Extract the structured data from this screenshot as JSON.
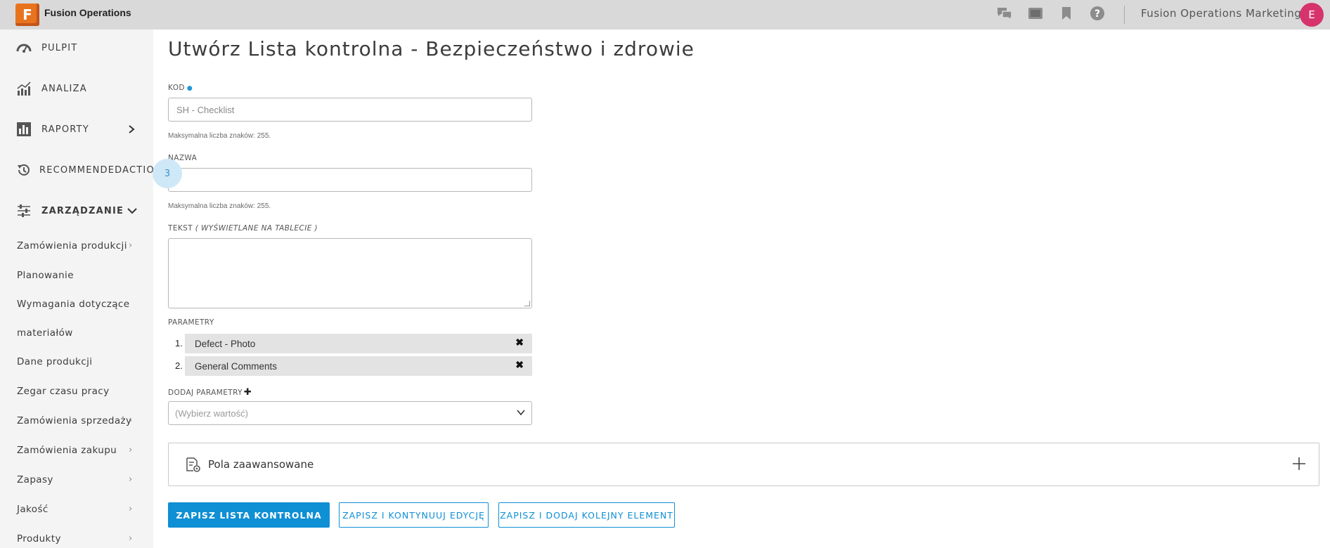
{
  "app": {
    "logo_letter": "F",
    "name": "Fusion Operations"
  },
  "topbar": {
    "icons": [
      "chat-icon",
      "tablet-icon",
      "bookmark-icon",
      "help-icon"
    ],
    "user_name": "Fusion Operations Marketing",
    "avatar_initial": "E"
  },
  "sidebar": {
    "main": [
      {
        "label": "PULPIT",
        "icon": "dashboard-icon"
      },
      {
        "label": "ANALIZA",
        "icon": "analytics-icon"
      },
      {
        "label": "RAPORTY",
        "icon": "reports-icon"
      },
      {
        "label": "RECOMMENDEDACTIONS",
        "icon": "history-icon"
      },
      {
        "label": "ZARZĄDZANIE",
        "icon": "sliders-icon"
      }
    ],
    "recommended_badge": "3",
    "sub": [
      {
        "label": "Zamówienia produkcji"
      },
      {
        "label": "Planowanie"
      },
      {
        "label": "Wymagania dotyczące"
      },
      {
        "label": "materiałów"
      },
      {
        "label": "Dane produkcji"
      },
      {
        "label": "Zegar czasu pracy"
      },
      {
        "label": "Zamówienia sprzedaży"
      },
      {
        "label": "Zamówienia zakupu"
      },
      {
        "label": "Zapasy"
      },
      {
        "label": "Jakość"
      },
      {
        "label": "Produkty"
      }
    ]
  },
  "form": {
    "title": "Utwórz Lista kontrolna - Bezpieczeństwo i zdrowie",
    "kod": {
      "label": "KOD",
      "placeholder": "SH - Checklist",
      "hint": "Maksymalna liczba znaków: 255."
    },
    "nazwa": {
      "label": "NAZWA",
      "value": "",
      "hint": "Maksymalna liczba znaków: 255."
    },
    "tekst": {
      "label": "TEKST",
      "label_note": "( WYŚWIETLANE NA TABLECIE )"
    },
    "parametry": {
      "label": "PARAMETRY",
      "items": [
        {
          "num": "1.",
          "name": "Defect - Photo"
        },
        {
          "num": "2.",
          "name": "General Comments"
        }
      ]
    },
    "dodaj": {
      "label": "DODAJ PARAMETRY",
      "placeholder": "(Wybierz wartość)"
    },
    "advanced_label": "Pola zaawansowane",
    "buttons": {
      "save": "ZAPISZ LISTA KONTROLNA",
      "save_continue": "ZAPISZ I KONTYNUUJ EDYCJĘ",
      "save_add": "ZAPISZ I DODAJ KOLEJNY ELEMENT"
    }
  },
  "colors": {
    "accent": "#0f8fd4",
    "logo": "#e8731e",
    "avatar": "#d6336c",
    "sidebar_bg": "#f4f4f4",
    "topbar_bg": "#d9d9d9"
  }
}
